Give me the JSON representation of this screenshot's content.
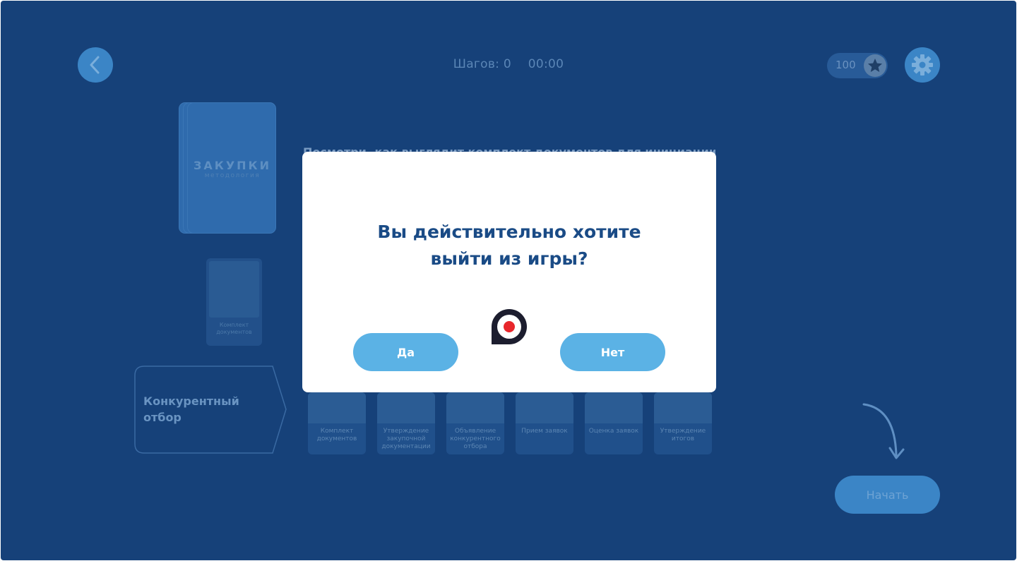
{
  "hud": {
    "steps": "Шагов: 0",
    "timer": "00:00",
    "score": "100"
  },
  "deck": {
    "title": "ЗАКУПКИ",
    "subtitle": "методология"
  },
  "small_card": {
    "caption": "Комплект документов"
  },
  "intro_text": "Посмотри, как выглядит комплект документов для инициации",
  "stage": {
    "label_line1": "Конкурентный",
    "label_line2": "отбор"
  },
  "stage_cards": [
    {
      "caption": "Комплект документов"
    },
    {
      "caption": "Утверждение закупочной документации"
    },
    {
      "caption": "Объявление конкурентного отбора"
    },
    {
      "caption": "Прием заявок"
    },
    {
      "caption": "Оценка заявок"
    },
    {
      "caption": "Утверждение итогов"
    }
  ],
  "start_button": "Начать",
  "modal": {
    "title_line1": "Вы действительно хотите",
    "title_line2": "выйти из игры?",
    "yes_label": "Да",
    "no_label": "Нет"
  },
  "icons": {
    "back": "chevron-left-icon",
    "settings": "gear-icon",
    "score": "star-icon",
    "recording": "record-indicator-icon"
  },
  "colors": {
    "background": "#164179",
    "modal_button": "#5bb2e5",
    "modal_title": "#1a4b86",
    "record_dot": "#e8262b"
  }
}
